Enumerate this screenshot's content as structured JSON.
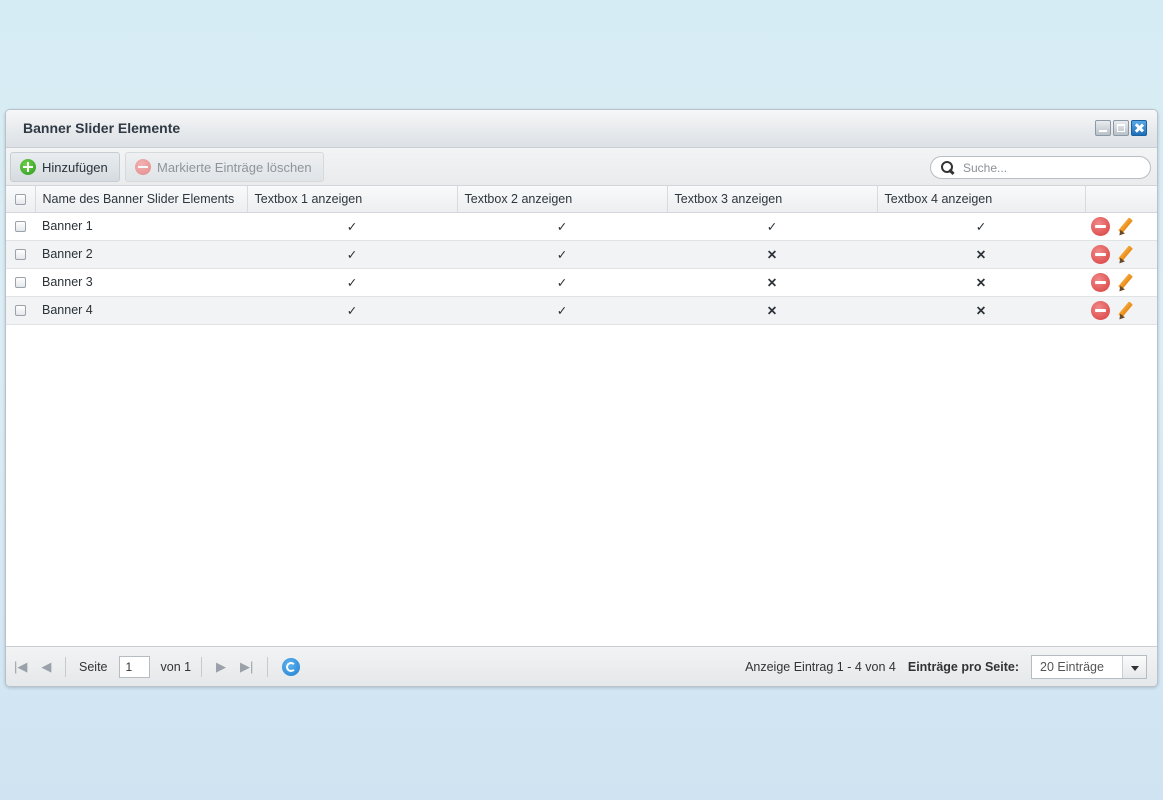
{
  "window": {
    "title": "Banner Slider Elemente"
  },
  "toolbar": {
    "add_label": "Hinzufügen",
    "delete_label": "Markierte Einträge löschen",
    "search_placeholder": "Suche..."
  },
  "grid": {
    "columns": [
      "Name des Banner Slider Elements",
      "Textbox 1 anzeigen",
      "Textbox 2 anzeigen",
      "Textbox 3 anzeigen",
      "Textbox 4 anzeigen"
    ],
    "rows": [
      {
        "name": "Banner 1",
        "textbox1": "✓",
        "textbox2": "✓",
        "textbox3": "✓",
        "textbox4": "✓"
      },
      {
        "name": "Banner 2",
        "textbox1": "✓",
        "textbox2": "✓",
        "textbox3": "✕",
        "textbox4": "✕"
      },
      {
        "name": "Banner 3",
        "textbox1": "✓",
        "textbox2": "✓",
        "textbox3": "✕",
        "textbox4": "✕"
      },
      {
        "name": "Banner 4",
        "textbox1": "✓",
        "textbox2": "✓",
        "textbox3": "✕",
        "textbox4": "✕"
      }
    ]
  },
  "pager": {
    "page_label": "Seite",
    "page_value": "1",
    "of_label": "von 1",
    "display_info": "Anzeige Eintrag 1 - 4 von 4",
    "per_page_label": "Einträge pro Seite:",
    "per_page_value": "20 Einträge"
  },
  "colors": {
    "check": "#4aa53c",
    "cross": "#d9453e",
    "accent": "#1f7fcf"
  }
}
